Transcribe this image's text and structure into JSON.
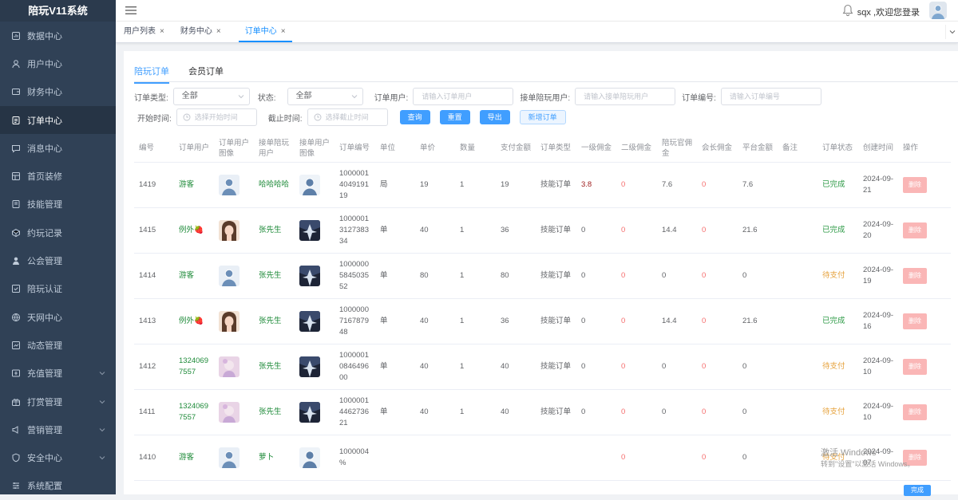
{
  "app": {
    "title": "陪玩V11系统"
  },
  "sidebar": {
    "items": [
      {
        "label": "数据中心",
        "icon": "dashboard-icon"
      },
      {
        "label": "用户中心",
        "icon": "user-icon"
      },
      {
        "label": "财务中心",
        "icon": "wallet-icon"
      },
      {
        "label": "订单中心",
        "icon": "document-icon"
      },
      {
        "label": "消息中心",
        "icon": "message-icon"
      },
      {
        "label": "首页装修",
        "icon": "home-decor-icon"
      },
      {
        "label": "技能管理",
        "icon": "skill-icon"
      },
      {
        "label": "约玩记录",
        "icon": "record-icon"
      },
      {
        "label": "公会管理",
        "icon": "guild-icon"
      },
      {
        "label": "陪玩认证",
        "icon": "certify-icon"
      },
      {
        "label": "天网中心",
        "icon": "network-icon"
      },
      {
        "label": "动态管理",
        "icon": "dynamic-icon"
      },
      {
        "label": "充值管理",
        "icon": "recharge-icon"
      },
      {
        "label": "打赏管理",
        "icon": "reward-icon"
      },
      {
        "label": "营销管理",
        "icon": "marketing-icon"
      },
      {
        "label": "安全中心",
        "icon": "security-icon"
      },
      {
        "label": "系统配置",
        "icon": "settings-icon"
      }
    ]
  },
  "header": {
    "welcome": "sqx ,欢迎您登录"
  },
  "tags": [
    {
      "label": "用户列表",
      "close": "×"
    },
    {
      "label": "财务中心",
      "close": "×"
    },
    {
      "label": "订单中心",
      "close": "×"
    }
  ],
  "subtabs": {
    "tab1": "陪玩订单",
    "tab2": "会员订单"
  },
  "filters": {
    "order_type_label": "订单类型:",
    "order_type_value": "全部",
    "status_label": "状态:",
    "status_value": "全部",
    "order_user_label": "订单用户:",
    "order_user_placeholder": "请输入订单用户",
    "taker_label": "接单陪玩用户:",
    "taker_placeholder": "请输入接单陪玩用户",
    "order_no_label": "订单编号:",
    "order_no_placeholder": "请输入订单编号",
    "start_label": "开始时间:",
    "start_placeholder": "选择开始时间",
    "end_label": "截止时间:",
    "end_placeholder": "选择截止时间",
    "btn_query": "查询",
    "btn_reset": "重置",
    "btn_export": "导出",
    "btn_add": "新增订单"
  },
  "table": {
    "headers": [
      "编号",
      "订单用户",
      "订单用户图像",
      "接单陪玩用户",
      "接单用户图像",
      "订单编号",
      "单位",
      "单价",
      "数量",
      "支付金额",
      "订单类型",
      "一级佣金",
      "二级佣金",
      "陪玩官佣金",
      "会长佣金",
      "平台金额",
      "备注",
      "订单状态",
      "创建时间",
      "操作"
    ],
    "rows": [
      {
        "id": "1419",
        "user": "游客",
        "taker": "哈哈哈哈",
        "order_no": "1000001\n4049191\n19",
        "unit": "局",
        "price": "19",
        "qty": "1",
        "pay": "19",
        "type": "技能订单",
        "c1": "3.8",
        "c2": "0",
        "c3": "7.6",
        "c4": "0",
        "platform": "7.6",
        "note": "",
        "status": "已完成",
        "created": "2024-09-21",
        "op": "删除"
      },
      {
        "id": "1415",
        "user": "例外🍓",
        "taker": "张先生",
        "order_no": "1000001\n3127383\n34",
        "unit": "单",
        "price": "40",
        "qty": "1",
        "pay": "36",
        "type": "技能订单",
        "c1": "0",
        "c2": "0",
        "c3": "14.4",
        "c4": "0",
        "platform": "21.6",
        "note": "",
        "status": "已完成",
        "created": "2024-09-20",
        "op": "删除"
      },
      {
        "id": "1414",
        "user": "游客",
        "taker": "张先生",
        "order_no": "1000000\n5845035\n52",
        "unit": "单",
        "price": "80",
        "qty": "1",
        "pay": "80",
        "type": "技能订单",
        "c1": "0",
        "c2": "0",
        "c3": "0",
        "c4": "0",
        "platform": "0",
        "note": "",
        "status": "待支付",
        "created": "2024-09-19",
        "op": "删除"
      },
      {
        "id": "1413",
        "user": "例外🍓",
        "taker": "张先生",
        "order_no": "1000000\n7167879\n48",
        "unit": "单",
        "price": "40",
        "qty": "1",
        "pay": "36",
        "type": "技能订单",
        "c1": "0",
        "c2": "0",
        "c3": "14.4",
        "c4": "0",
        "platform": "21.6",
        "note": "",
        "status": "已完成",
        "created": "2024-09-16",
        "op": "删除"
      },
      {
        "id": "1412",
        "user": "1324069\n7557",
        "taker": "张先生",
        "order_no": "1000001\n0846496\n00",
        "unit": "单",
        "price": "40",
        "qty": "1",
        "pay": "40",
        "type": "技能订单",
        "c1": "0",
        "c2": "0",
        "c3": "0",
        "c4": "0",
        "platform": "0",
        "note": "",
        "status": "待支付",
        "created": "2024-09-10",
        "op": "删除"
      },
      {
        "id": "1411",
        "user": "1324069\n7557",
        "taker": "张先生",
        "order_no": "1000001\n4462736\n21",
        "unit": "单",
        "price": "40",
        "qty": "1",
        "pay": "40",
        "type": "技能订单",
        "c1": "0",
        "c2": "0",
        "c3": "0",
        "c4": "0",
        "platform": "0",
        "note": "",
        "status": "待支付",
        "created": "2024-09-10",
        "op": "删除"
      },
      {
        "id": "1410",
        "user": "游客",
        "taker": "萝卜",
        "order_no": "1000004\n%",
        "unit": "",
        "price": "",
        "qty": "",
        "pay": "",
        "type": "",
        "c1": "",
        "c2": "0",
        "c3": "",
        "c4": "0",
        "platform": "0",
        "note": "",
        "status": "待支付",
        "created": "2024-09-07",
        "op": "删除"
      }
    ]
  },
  "watermark": {
    "line1": "激活 Windows",
    "line2": "转到\"设置\"以激活 Windows。"
  },
  "confirm_label": "完成",
  "colors": {
    "sidebar": "#304156",
    "accent": "#409eff",
    "success": "#2d9a46",
    "warning": "#e6a23c"
  }
}
